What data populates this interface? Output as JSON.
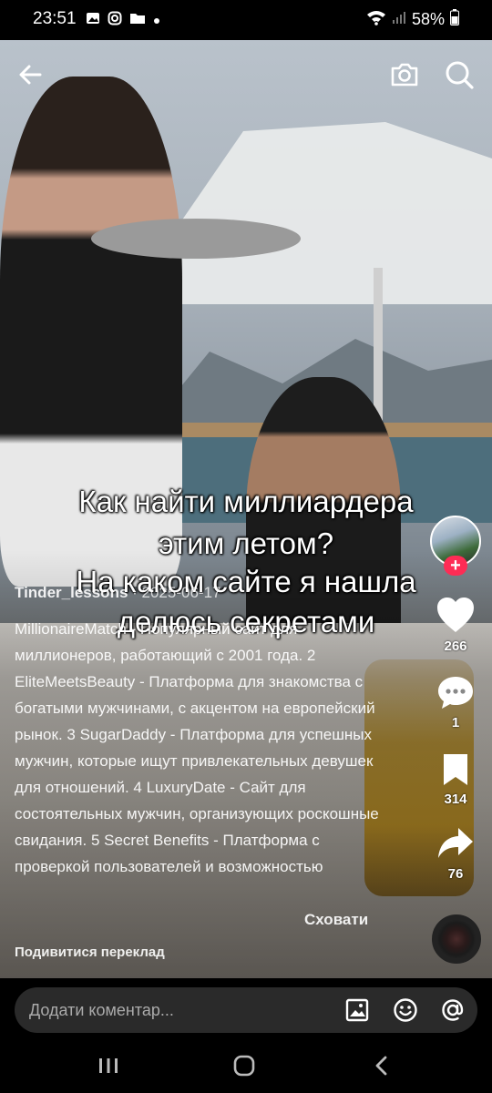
{
  "status": {
    "time": "23:51",
    "battery": "58%"
  },
  "caption": {
    "line1": "Как найти миллиардера",
    "line2": "этим летом?",
    "line3": "На каком сайте я нашла",
    "line4": "делюсь секретами"
  },
  "post": {
    "author": "Tinder_lessons",
    "date": " · 2025-06-17",
    "description": "MillionaireMatch - Популярный сайт для миллионеров, работающий с 2001 года.  2 EliteMeetsBeauty - Платформа для знакомства с богатыми мужчинами, с акцентом на европейский рынок.  3 SugarDaddy - Платформа для успешных мужчин, которые ищут привлекательных девушек для отношений.  4 LuxuryDate - Сайт для состоятельных мужчин, организующих роскошные свидания.  5 Secret Benefits - Платформа с проверкой пользователей и возможностью",
    "hide_label": "Сховати",
    "translate_label": "Подивитися переклад"
  },
  "side_actions": {
    "likes": "266",
    "comments": "1",
    "saves": "314",
    "shares": "76",
    "follow": "+"
  },
  "comment_bar": {
    "placeholder": "Додати коментар..."
  },
  "colors": {
    "accent": "#fe2c55",
    "bar_bg": "#2a2a2a"
  },
  "icons": [
    "back-arrow-icon",
    "camera-icon",
    "search-icon",
    "heart-icon",
    "comment-icon",
    "bookmark-icon",
    "share-icon",
    "image-icon",
    "emoji-icon",
    "mention-icon"
  ]
}
